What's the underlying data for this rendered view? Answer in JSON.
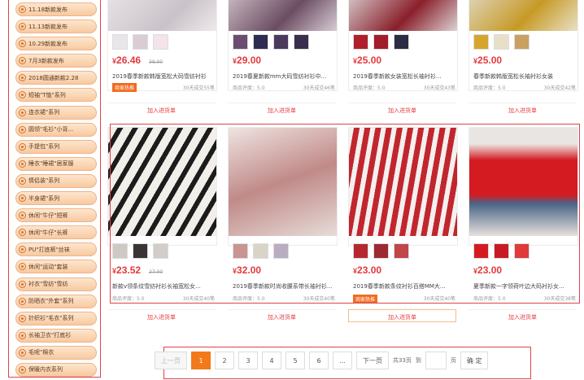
{
  "sidebar": {
    "items": [
      {
        "label": "11.18新款发布"
      },
      {
        "label": "11.13新款发布"
      },
      {
        "label": "10.29新款发布"
      },
      {
        "label": "7月3新款发布"
      },
      {
        "label": "2018圆通新款2.28"
      },
      {
        "label": "短袖\"T恤\"系列"
      },
      {
        "label": "连衣裙\"系列"
      },
      {
        "label": "圆领\"毛衫\"小背..."
      },
      {
        "label": "手提包\"系列"
      },
      {
        "label": "睡衣\"睡裙\"居家服"
      },
      {
        "label": "情侣装\"系列"
      },
      {
        "label": "半身裙\"系列"
      },
      {
        "label": "休闲\"牛仔\"短裤"
      },
      {
        "label": "休闲\"牛仔\"长裤"
      },
      {
        "label": "PU\"打底裤\"丝袜"
      },
      {
        "label": "休闲\"运动\"套装"
      },
      {
        "label": "衬衣\"雪纺\"雪纺"
      },
      {
        "label": "防晒衣\"外套\"系列"
      },
      {
        "label": "针织衫\"毛衣\"系列"
      },
      {
        "label": "长袖卫衣\"打底衫"
      },
      {
        "label": "毛呢\"棉衣"
      },
      {
        "label": "保暖内衣系列"
      }
    ]
  },
  "top_row": [
    {
      "price": "26.46",
      "old_price": "38.00",
      "title": "2019春季新款韩版宽松大码雪纺衬衫",
      "rating": "商品评度：5.0",
      "sales": "30天成交55笔",
      "badge": "商家热推",
      "button": "加入进货单"
    },
    {
      "price": "29.00",
      "old_price": "",
      "title": "2019春夏新款mm大码雪纺衬衫中...",
      "rating": "商品评度：5.0",
      "sales": "30天成交46笔",
      "badge": "",
      "button": "加入进货单"
    },
    {
      "price": "25.00",
      "old_price": "",
      "title": "2019春季新款女装宽松长袖衬衫...",
      "rating": "商品评度：5.0",
      "sales": "30天成交43笔",
      "badge": "",
      "button": "加入进货单"
    },
    {
      "price": "25.00",
      "old_price": "",
      "title": "春季新款韩版宽松长袖衬衫女装",
      "rating": "商品评度：5.0",
      "sales": "30天成交42笔",
      "badge": "",
      "button": "加入进货单"
    }
  ],
  "bottom_row": [
    {
      "price": "23.52",
      "old_price": "27.00",
      "title": "新款v领条纹雪纺衬衫长袖宽松女...",
      "rating": "商品评度：5.0",
      "sales": "30天成交40笔",
      "badge": "",
      "button": "加入进货单"
    },
    {
      "price": "32.00",
      "old_price": "",
      "title": "2019春季新款时尚收腰系带长袖衬衫...",
      "rating": "商品评度：5.0",
      "sales": "30天成交40笔",
      "badge": "",
      "button": "加入进货单"
    },
    {
      "price": "23.00",
      "old_price": "",
      "title": "2019春季新款条纹衬衫百搭MM大...",
      "rating": "商品评度：5.0",
      "sales": "30天成交40笔",
      "badge": "商家热推",
      "button": "加入进货单"
    },
    {
      "price": "23.00",
      "old_price": "",
      "title": "夏季新款一字领荷叶边大码衬衫女...",
      "rating": "商品评度：5.0",
      "sales": "30天成交38笔",
      "badge": "",
      "button": "加入进货单"
    }
  ],
  "currency": "¥",
  "pagination": {
    "prev": "上一页",
    "pages": [
      "1",
      "2",
      "3",
      "4",
      "5",
      "6"
    ],
    "ellipsis": "...",
    "next": "下一页",
    "total": "共33页",
    "goto": "到",
    "page_unit": "页",
    "confirm": "确 定"
  },
  "colors": {
    "accent": "#e4393c",
    "page_active": "#f27a1a"
  }
}
